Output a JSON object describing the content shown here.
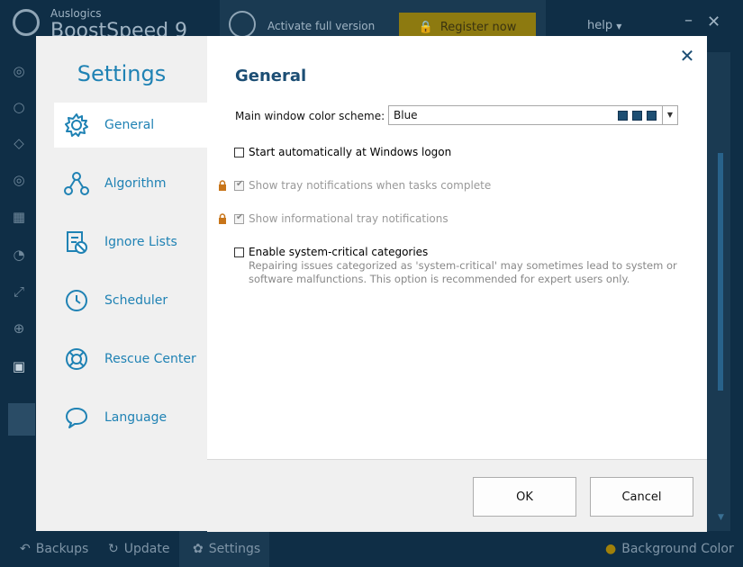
{
  "app": {
    "brand_small": "Auslogics",
    "brand_big": "BoostSpeed 9",
    "activate_text": "Activate full version",
    "register_label": "Register now",
    "help_label": "help",
    "minimize_glyph": "–",
    "close_glyph": "✕"
  },
  "bottom_bar": {
    "backups": "Backups",
    "update": "Update",
    "settings": "Settings",
    "background_color": "Background Color"
  },
  "dialog": {
    "nav_title": "Settings",
    "nav_items": [
      {
        "label": "General",
        "icon": "gear-icon"
      },
      {
        "label": "Algorithm",
        "icon": "algorithm-icon"
      },
      {
        "label": "Ignore Lists",
        "icon": "ignore-list-icon"
      },
      {
        "label": "Scheduler",
        "icon": "clock-icon"
      },
      {
        "label": "Rescue Center",
        "icon": "lifebuoy-icon"
      },
      {
        "label": "Language",
        "icon": "speech-bubble-icon"
      }
    ],
    "section_title": "General",
    "close_glyph": "✕",
    "color_scheme_label": "Main window color scheme:",
    "color_scheme_value": "Blue",
    "color_scheme_swatch": "#1e4f73",
    "options": {
      "start_auto": "Start automatically at Windows logon",
      "tray_tasks": "Show tray notifications when tasks complete",
      "tray_info": "Show informational tray notifications",
      "system_critical": "Enable system-critical categories",
      "system_critical_desc": "Repairing issues categorized as 'system-critical' may sometimes lead to system or software malfunctions. This option is recommended for expert users only."
    },
    "ok_label": "OK",
    "cancel_label": "Cancel"
  },
  "colors": {
    "accent": "#1f82b4",
    "heading": "#1c4e74",
    "app_bg": "#0f2e46",
    "lock": "#c8751a"
  }
}
